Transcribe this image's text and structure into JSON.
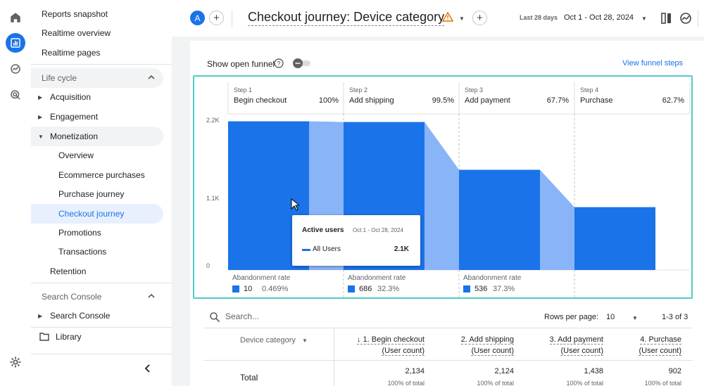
{
  "rail": {
    "icons": [
      "home-icon",
      "reports-icon",
      "explore-icon",
      "advertising-icon",
      "settings-icon"
    ]
  },
  "sidebar": {
    "top_items": [
      "Reports snapshot",
      "Realtime overview",
      "Realtime pages"
    ],
    "lifecycle_label": "Life cycle",
    "acquisition": "Acquisition",
    "engagement": "Engagement",
    "monetization": "Monetization",
    "monetization_children": [
      "Overview",
      "Ecommerce purchases",
      "Purchase journey",
      "Checkout journey",
      "Promotions",
      "Transactions"
    ],
    "retention": "Retention",
    "search_console_section": "Search Console",
    "search_console_item": "Search Console",
    "library": "Library"
  },
  "header": {
    "avatar_letter": "A",
    "title": "Checkout journey: Device category",
    "date_label": "Last 28 days",
    "date_range": "Oct 1 - Oct 28, 2024"
  },
  "funnel": {
    "show_open_funnel": "Show open funnel",
    "view_funnel_steps": "View funnel steps",
    "yticks": [
      "2.2K",
      "1.1K",
      "0"
    ],
    "steps": [
      {
        "num": "Step 1",
        "name": "Begin checkout",
        "pct": "100%"
      },
      {
        "num": "Step 2",
        "name": "Add shipping",
        "pct": "99.5%"
      },
      {
        "num": "Step 3",
        "name": "Add payment",
        "pct": "67.7%"
      },
      {
        "num": "Step 4",
        "name": "Purchase",
        "pct": "62.7%"
      }
    ],
    "abandonment_label": "Abandonment rate",
    "abandonment": [
      {
        "count": "10",
        "rate": "0.469%"
      },
      {
        "count": "686",
        "rate": "32.3%"
      },
      {
        "count": "536",
        "rate": "37.3%"
      }
    ],
    "tooltip": {
      "title": "Active users",
      "date": "Oct 1 - Oct 28, 2024",
      "series": "All Users",
      "value": "2.1K"
    }
  },
  "chart_data": {
    "type": "bar",
    "categories": [
      "Begin checkout",
      "Add shipping",
      "Add payment",
      "Purchase"
    ],
    "values": [
      2134,
      2124,
      1438,
      902
    ],
    "ylim": [
      0,
      2200
    ],
    "yticks": [
      "0",
      "1.1K",
      "2.2K"
    ],
    "colors": {
      "bar": "#1a73e8",
      "abandon": "#8ab4f8"
    }
  },
  "table": {
    "search_placeholder": "Search...",
    "rows_per_page_label": "Rows per page:",
    "rows_per_page": "10",
    "page_info": "1-3 of 3",
    "dimension_header": "Device category",
    "columns": [
      {
        "title": "↓ 1. Begin checkout",
        "sub": "(User count)"
      },
      {
        "title": "2. Add shipping",
        "sub": "(User count)"
      },
      {
        "title": "3. Add payment",
        "sub": "(User count)"
      },
      {
        "title": "4. Purchase",
        "sub": "(User count)"
      }
    ],
    "total_label": "Total",
    "totals": [
      "2,134",
      "2,124",
      "1,438",
      "902"
    ],
    "total_sub": "100% of total"
  }
}
